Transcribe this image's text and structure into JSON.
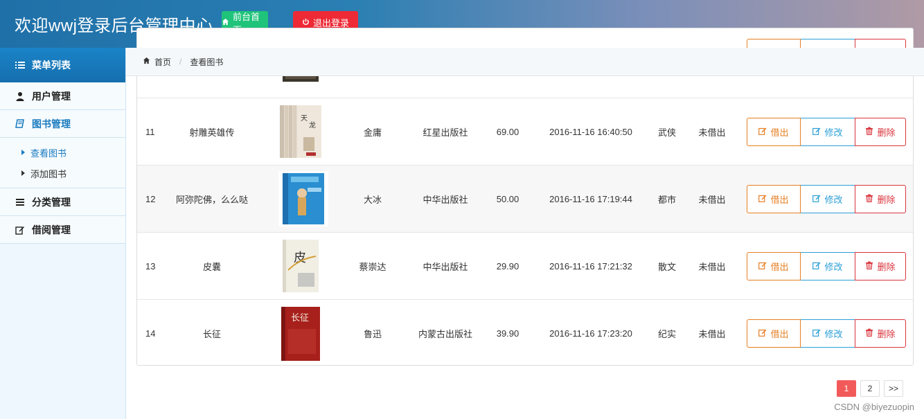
{
  "header": {
    "title": "欢迎wwj登录后台管理中心",
    "home_button": "前台首页",
    "logout_button": "退出登录"
  },
  "sidebar": {
    "head": "菜单列表",
    "items": [
      {
        "label": "用户管理",
        "icon": "user-icon"
      },
      {
        "label": "图书管理",
        "icon": "book-icon"
      },
      {
        "label": "分类管理",
        "icon": "list-icon"
      },
      {
        "label": "借阅管理",
        "icon": "edit-icon"
      }
    ],
    "sub_items": [
      {
        "label": "查看图书"
      },
      {
        "label": "添加图书"
      }
    ]
  },
  "breadcrumb": {
    "home": "首页",
    "current": "查看图书"
  },
  "table": {
    "rows": [
      {
        "id": "11",
        "name": "射雕英雄传",
        "author": "金庸",
        "publisher": "红星出版社",
        "price": "69.00",
        "date": "2016-11-16 16:40:50",
        "category": "武侠",
        "status": "未借出"
      },
      {
        "id": "12",
        "name": "阿弥陀佛，么么哒",
        "author": "大冰",
        "publisher": "中华出版社",
        "price": "50.00",
        "date": "2016-11-16 17:19:44",
        "category": "都市",
        "status": "未借出"
      },
      {
        "id": "13",
        "name": "皮囊",
        "author": "蔡崇达",
        "publisher": "中华出版社",
        "price": "29.90",
        "date": "2016-11-16 17:21:32",
        "category": "散文",
        "status": "未借出"
      },
      {
        "id": "14",
        "name": "长征",
        "author": "鲁迅",
        "publisher": "内蒙古出版社",
        "price": "39.90",
        "date": "2016-11-16 17:23:20",
        "category": "纪实",
        "status": "未借出"
      }
    ],
    "actions": {
      "borrow": "借出",
      "edit": "修改",
      "delete": "删除"
    }
  },
  "pagination": {
    "pages": [
      "1",
      "2"
    ],
    "next": ">>",
    "current": "1"
  },
  "watermark": "CSDN @biyezuopin",
  "colors": {
    "accent": "#1a7bbf",
    "borrow": "#e67e22",
    "edit": "#2a9fd6",
    "delete": "#d9343c",
    "page_active": "#f25a5a"
  }
}
